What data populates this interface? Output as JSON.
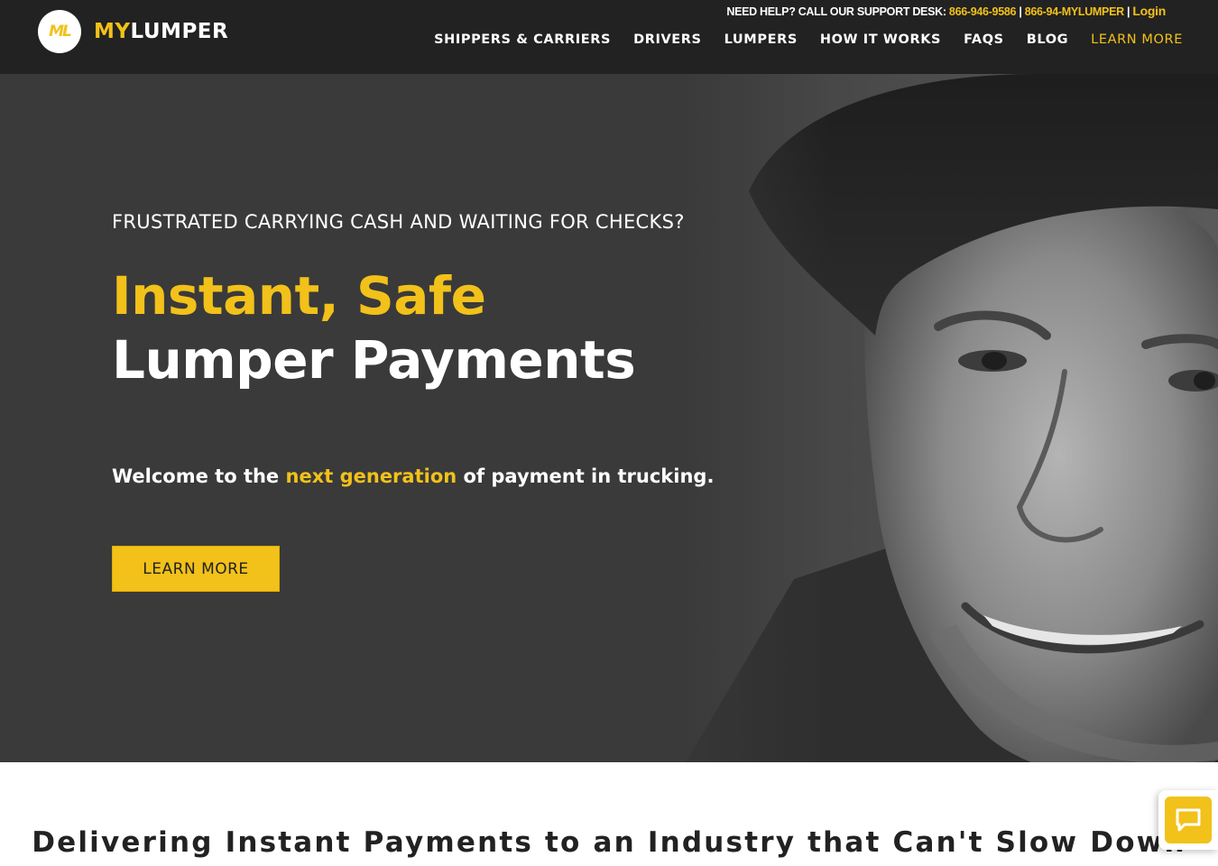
{
  "header": {
    "logo": {
      "mark": "ML",
      "name_part1": "MY",
      "name_part2": "LUMPER"
    },
    "support": {
      "prefix": "NEED HELP? CALL OUR SUPPORT DESK:",
      "phone1": "866-946-9586",
      "separator1": " | ",
      "phone2": "866-94-MYLUMPER",
      "separator2": "  | ",
      "login": "Login"
    },
    "nav": [
      {
        "label": "SHIPPERS & CARRIERS"
      },
      {
        "label": "DRIVERS"
      },
      {
        "label": "LUMPERS"
      },
      {
        "label": "HOW IT WORKS"
      },
      {
        "label": "FAQS"
      },
      {
        "label": "BLOG"
      },
      {
        "label": "LEARN MORE"
      }
    ]
  },
  "hero": {
    "eyebrow": "FRUSTRATED CARRYING CASH AND WAITING FOR CHECKS?",
    "title_line1": "Instant, Safe",
    "title_line2": "Lumper Payments",
    "tagline_before": "Welcome to the ",
    "tagline_highlight": "next generation",
    "tagline_after": " of payment in trucking.",
    "button_label": "LEARN MORE"
  },
  "section": {
    "heading": "Delivering Instant Payments to an Industry that Can't Slow Down"
  },
  "colors": {
    "brand_yellow": "#f2c11a",
    "header_bg": "#222222",
    "hero_bg": "#3a3a3a"
  },
  "icons": {
    "chat": "chat-bubble-icon"
  }
}
